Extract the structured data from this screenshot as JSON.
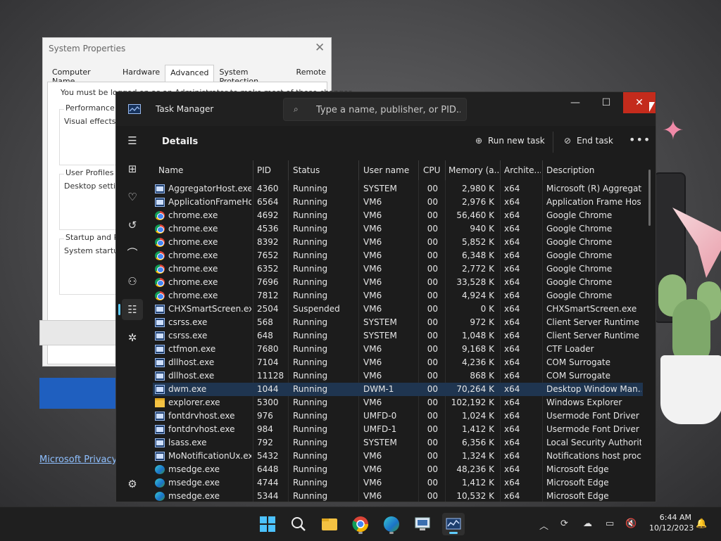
{
  "system_properties": {
    "title": "System Properties",
    "tabs": [
      "Computer Name",
      "Hardware",
      "Advanced",
      "System Protection",
      "Remote"
    ],
    "active_tab": "Advanced",
    "note": "You must be logged on as an Administrator to make most of these changes.",
    "groups": [
      {
        "title": "Performance",
        "desc": "Visual effects, p"
      },
      {
        "title": "User Profiles",
        "desc": "Desktop setting"
      },
      {
        "title": "Startup and Rec",
        "desc": "System startup, "
      }
    ],
    "privacy_link": "Microsoft Privacy"
  },
  "task_manager": {
    "title": "Task Manager",
    "search_placeholder": "Type a name, publisher, or PID...",
    "page_title": "Details",
    "commands": {
      "run_new_task": "Run new task",
      "end_task": "End task"
    },
    "columns": [
      "Name",
      "PID",
      "Status",
      "User name",
      "CPU",
      "Memory (a...",
      "Archite...",
      "Description"
    ],
    "rows": [
      {
        "icon": "exe-icon",
        "name": "AggregatorHost.exe",
        "pid": "4360",
        "status": "Running",
        "user": "SYSTEM",
        "cpu": "00",
        "memory": "2,980 K",
        "arch": "x64",
        "desc": "Microsoft (R) Aggregat..."
      },
      {
        "icon": "exe-icon",
        "name": "ApplicationFrameHo...",
        "pid": "6564",
        "status": "Running",
        "user": "VM6",
        "cpu": "00",
        "memory": "2,976 K",
        "arch": "x64",
        "desc": "Application Frame Host"
      },
      {
        "icon": "chrome-icon",
        "name": "chrome.exe",
        "pid": "4692",
        "status": "Running",
        "user": "VM6",
        "cpu": "00",
        "memory": "56,460 K",
        "arch": "x64",
        "desc": "Google Chrome"
      },
      {
        "icon": "chrome-icon",
        "name": "chrome.exe",
        "pid": "4536",
        "status": "Running",
        "user": "VM6",
        "cpu": "00",
        "memory": "940 K",
        "arch": "x64",
        "desc": "Google Chrome"
      },
      {
        "icon": "chrome-icon",
        "name": "chrome.exe",
        "pid": "8392",
        "status": "Running",
        "user": "VM6",
        "cpu": "00",
        "memory": "5,852 K",
        "arch": "x64",
        "desc": "Google Chrome"
      },
      {
        "icon": "chrome-icon",
        "name": "chrome.exe",
        "pid": "7652",
        "status": "Running",
        "user": "VM6",
        "cpu": "00",
        "memory": "6,348 K",
        "arch": "x64",
        "desc": "Google Chrome"
      },
      {
        "icon": "chrome-icon",
        "name": "chrome.exe",
        "pid": "6352",
        "status": "Running",
        "user": "VM6",
        "cpu": "00",
        "memory": "2,772 K",
        "arch": "x64",
        "desc": "Google Chrome"
      },
      {
        "icon": "chrome-icon",
        "name": "chrome.exe",
        "pid": "7696",
        "status": "Running",
        "user": "VM6",
        "cpu": "00",
        "memory": "33,528 K",
        "arch": "x64",
        "desc": "Google Chrome"
      },
      {
        "icon": "chrome-icon",
        "name": "chrome.exe",
        "pid": "7812",
        "status": "Running",
        "user": "VM6",
        "cpu": "00",
        "memory": "4,924 K",
        "arch": "x64",
        "desc": "Google Chrome"
      },
      {
        "icon": "exe-icon",
        "name": "CHXSmartScreen.exe",
        "pid": "2504",
        "status": "Suspended",
        "user": "VM6",
        "cpu": "00",
        "memory": "0 K",
        "arch": "x64",
        "desc": "CHXSmartScreen.exe"
      },
      {
        "icon": "exe-icon",
        "name": "csrss.exe",
        "pid": "568",
        "status": "Running",
        "user": "SYSTEM",
        "cpu": "00",
        "memory": "972 K",
        "arch": "x64",
        "desc": "Client Server Runtime ..."
      },
      {
        "icon": "exe-icon",
        "name": "csrss.exe",
        "pid": "648",
        "status": "Running",
        "user": "SYSTEM",
        "cpu": "00",
        "memory": "1,048 K",
        "arch": "x64",
        "desc": "Client Server Runtime ..."
      },
      {
        "icon": "exe-icon",
        "name": "ctfmon.exe",
        "pid": "7680",
        "status": "Running",
        "user": "VM6",
        "cpu": "00",
        "memory": "9,168 K",
        "arch": "x64",
        "desc": "CTF Loader"
      },
      {
        "icon": "exe-icon",
        "name": "dllhost.exe",
        "pid": "7104",
        "status": "Running",
        "user": "VM6",
        "cpu": "00",
        "memory": "4,236 K",
        "arch": "x64",
        "desc": "COM Surrogate"
      },
      {
        "icon": "exe-icon",
        "name": "dllhost.exe",
        "pid": "11128",
        "status": "Running",
        "user": "VM6",
        "cpu": "00",
        "memory": "868 K",
        "arch": "x64",
        "desc": "COM Surrogate"
      },
      {
        "icon": "exe-icon",
        "name": "dwm.exe",
        "pid": "1044",
        "status": "Running",
        "user": "DWM-1",
        "cpu": "00",
        "memory": "70,264 K",
        "arch": "x64",
        "desc": "Desktop Window Man...",
        "selected": true
      },
      {
        "icon": "folder-icon",
        "name": "explorer.exe",
        "pid": "5300",
        "status": "Running",
        "user": "VM6",
        "cpu": "00",
        "memory": "102,192 K",
        "arch": "x64",
        "desc": "Windows Explorer"
      },
      {
        "icon": "exe-icon",
        "name": "fontdrvhost.exe",
        "pid": "976",
        "status": "Running",
        "user": "UMFD-0",
        "cpu": "00",
        "memory": "1,024 K",
        "arch": "x64",
        "desc": "Usermode Font Driver ..."
      },
      {
        "icon": "exe-icon",
        "name": "fontdrvhost.exe",
        "pid": "984",
        "status": "Running",
        "user": "UMFD-1",
        "cpu": "00",
        "memory": "1,412 K",
        "arch": "x64",
        "desc": "Usermode Font Driver ..."
      },
      {
        "icon": "exe-icon",
        "name": "lsass.exe",
        "pid": "792",
        "status": "Running",
        "user": "SYSTEM",
        "cpu": "00",
        "memory": "6,356 K",
        "arch": "x64",
        "desc": "Local Security Authorit..."
      },
      {
        "icon": "exe-icon",
        "name": "MoNotificationUx.exe",
        "pid": "5432",
        "status": "Running",
        "user": "VM6",
        "cpu": "00",
        "memory": "1,324 K",
        "arch": "x64",
        "desc": "Notifications host proc..."
      },
      {
        "icon": "edge-icon",
        "name": "msedge.exe",
        "pid": "6448",
        "status": "Running",
        "user": "VM6",
        "cpu": "00",
        "memory": "48,236 K",
        "arch": "x64",
        "desc": "Microsoft Edge"
      },
      {
        "icon": "edge-icon",
        "name": "msedge.exe",
        "pid": "4744",
        "status": "Running",
        "user": "VM6",
        "cpu": "00",
        "memory": "1,412 K",
        "arch": "x64",
        "desc": "Microsoft Edge"
      },
      {
        "icon": "edge-icon",
        "name": "msedge.exe",
        "pid": "5344",
        "status": "Running",
        "user": "VM6",
        "cpu": "00",
        "memory": "10,532 K",
        "arch": "x64",
        "desc": "Microsoft Edge"
      }
    ]
  },
  "taskbar": {
    "time": "6:44 AM",
    "date": "10/12/2023",
    "apps": [
      "start-icon",
      "search-icon",
      "file-explorer-icon",
      "chrome-icon",
      "edge-icon",
      "remote-desktop-icon",
      "task-manager-icon"
    ]
  },
  "colors": {
    "accent": "#60cdff",
    "close_button": "#c42b1c",
    "selected_row": "#1f3550"
  }
}
